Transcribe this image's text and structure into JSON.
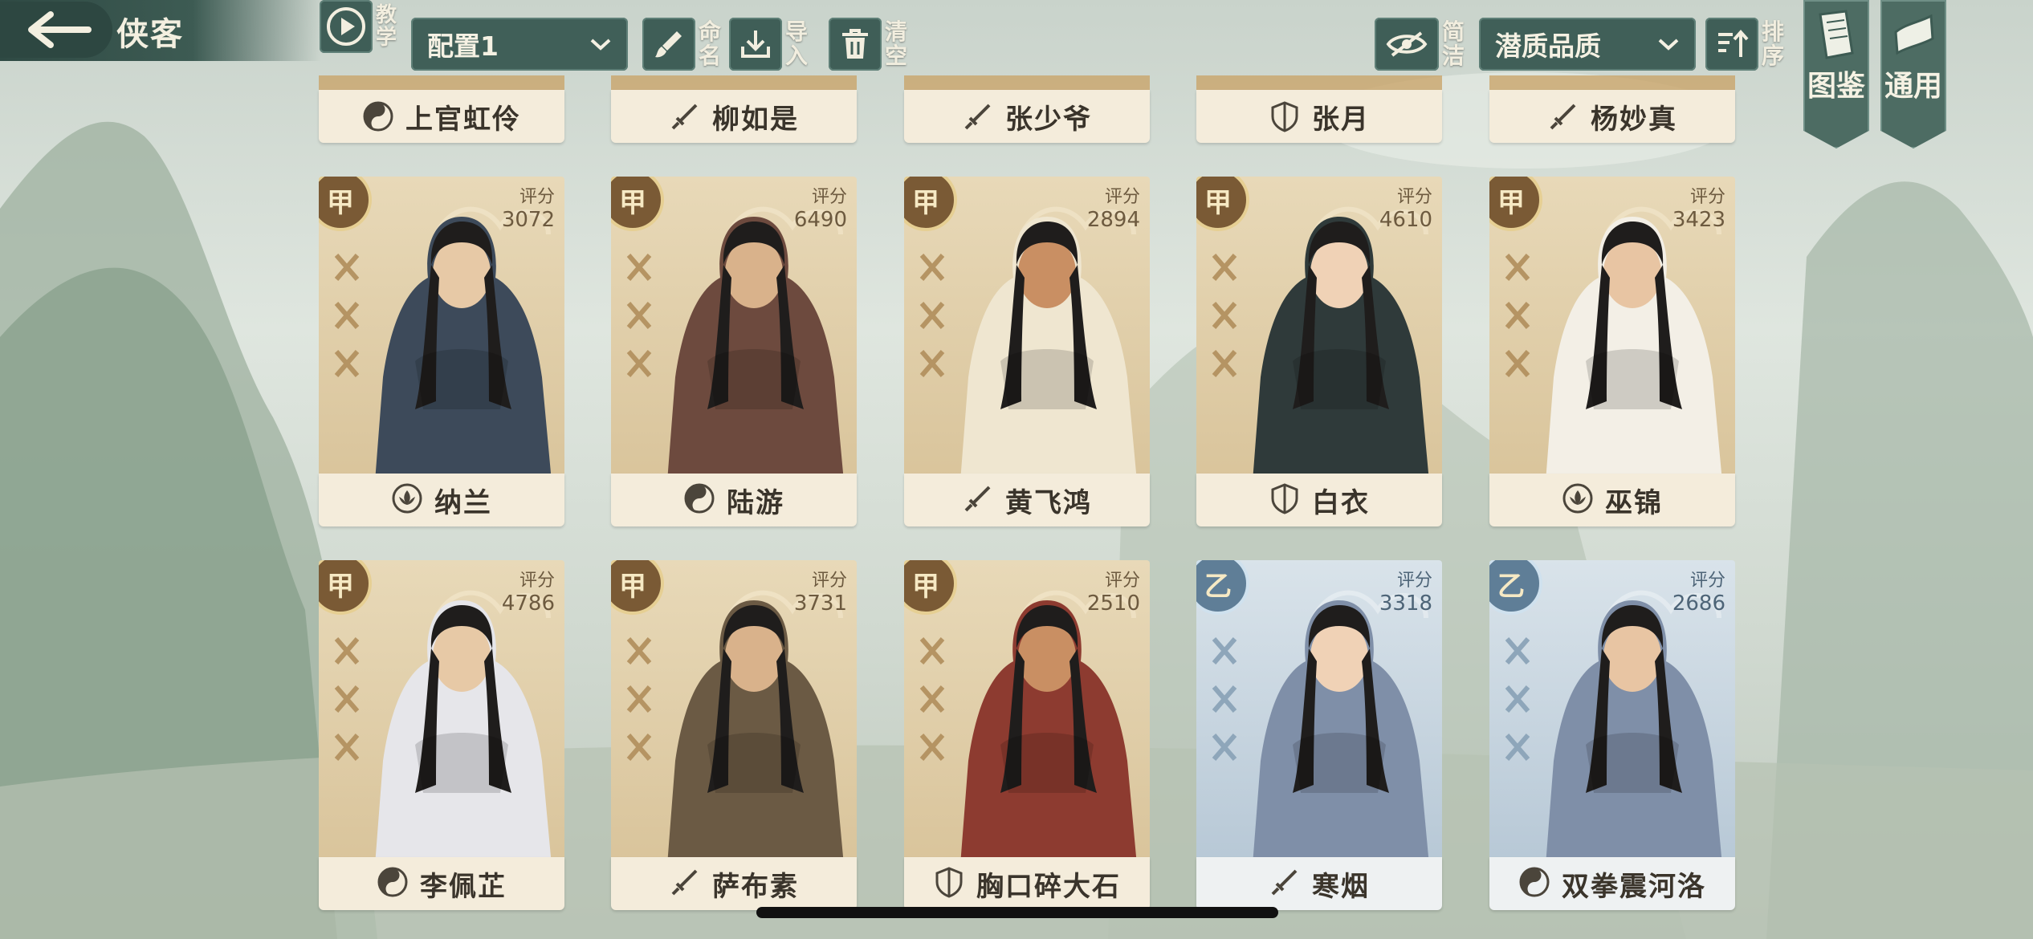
{
  "header": {
    "title": "侠客",
    "tutorial_label": "教学",
    "config_select": "配置1",
    "rename_label": "命名",
    "import_label": "导入",
    "clear_label": "清空",
    "simple_label": "简洁",
    "sort_select": "潜质品质",
    "sort_label": "排序"
  },
  "side_tabs": [
    {
      "label": "图鉴"
    },
    {
      "label": "通用"
    }
  ],
  "top_row": [
    {
      "name": "上官虹伶",
      "sect_icon": "yin-yang-icon"
    },
    {
      "name": "柳如是",
      "sect_icon": "sword-icon"
    },
    {
      "name": "张少爷",
      "sect_icon": "sword-icon"
    },
    {
      "name": "张月",
      "sect_icon": "shield-icon"
    },
    {
      "name": "杨妙真",
      "sect_icon": "sword-icon"
    }
  ],
  "cards": [
    {
      "grade": "甲",
      "score_label": "评分",
      "score": "3072",
      "name": "纳兰",
      "sect_icon": "lotus-icon",
      "tier": "gold"
    },
    {
      "grade": "甲",
      "score_label": "评分",
      "score": "6490",
      "name": "陆游",
      "sect_icon": "yin-yang-icon",
      "tier": "gold"
    },
    {
      "grade": "甲",
      "score_label": "评分",
      "score": "2894",
      "name": "黄飞鸿",
      "sect_icon": "sword-icon",
      "tier": "gold"
    },
    {
      "grade": "甲",
      "score_label": "评分",
      "score": "4610",
      "name": "白衣",
      "sect_icon": "shield-icon",
      "tier": "gold"
    },
    {
      "grade": "甲",
      "score_label": "评分",
      "score": "3423",
      "name": "巫锦",
      "sect_icon": "lotus-icon",
      "tier": "gold"
    },
    {
      "grade": "甲",
      "score_label": "评分",
      "score": "4786",
      "name": "李佩芷",
      "sect_icon": "yin-yang-icon",
      "tier": "gold"
    },
    {
      "grade": "甲",
      "score_label": "评分",
      "score": "3731",
      "name": "萨布素",
      "sect_icon": "sword-icon",
      "tier": "gold"
    },
    {
      "grade": "甲",
      "score_label": "评分",
      "score": "2510",
      "name": "胸口碎大石",
      "sect_icon": "shield-icon",
      "tier": "gold"
    },
    {
      "grade": "乙",
      "score_label": "评分",
      "score": "3318",
      "name": "寒烟",
      "sect_icon": "sword-icon",
      "tier": "blue"
    },
    {
      "grade": "乙",
      "score_label": "评分",
      "score": "2686",
      "name": "双拳震河洛",
      "sect_icon": "yin-yang-icon",
      "tier": "blue"
    }
  ],
  "colors": {
    "gold_card": "#d9c49b",
    "blue_card": "#b7c8d6",
    "toolbar": "#405f58",
    "gold_grade": "#7a5a35",
    "blue_grade": "#5f7e97"
  }
}
